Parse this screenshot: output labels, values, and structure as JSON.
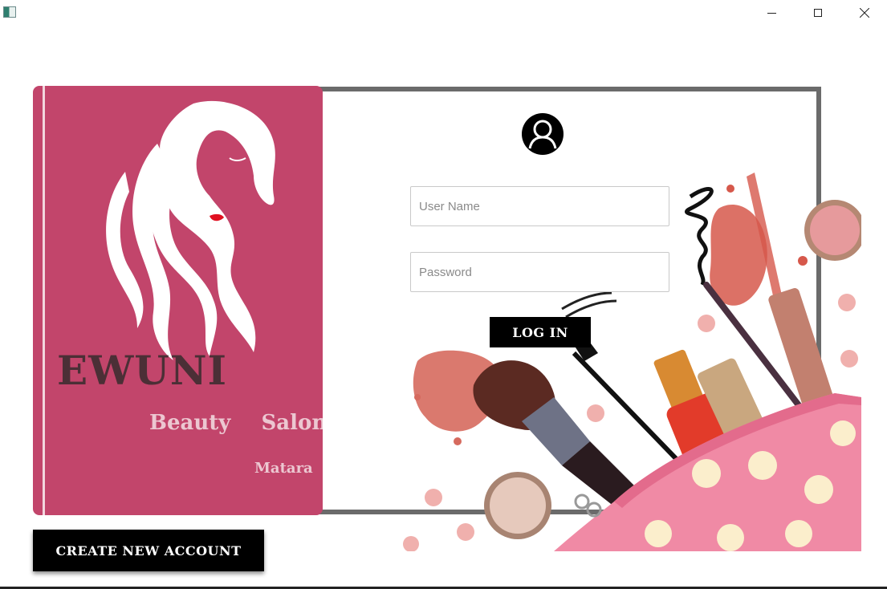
{
  "window": {
    "minimize_icon": "minimize-icon",
    "maximize_icon": "maximize-icon",
    "close_icon": "close-icon"
  },
  "brand": {
    "name": "EWUNI",
    "subtitle": "Beauty  Salon",
    "city": "Matara",
    "panel_color": "#c2456b"
  },
  "login": {
    "avatar_icon": "user-avatar-icon",
    "username_placeholder": "User Name",
    "username_value": "",
    "password_placeholder": "Password",
    "password_value": "",
    "login_label": "LOG IN"
  },
  "account": {
    "create_label": "CREATE NEW ACCOUNT"
  }
}
